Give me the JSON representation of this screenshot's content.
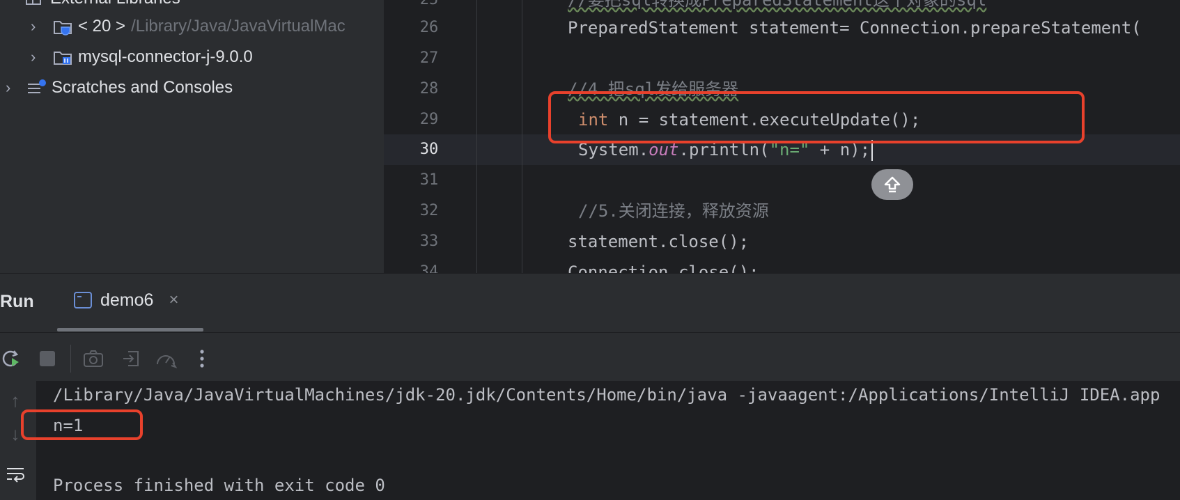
{
  "project_tree": {
    "items": [
      {
        "label": "External Libraries",
        "dim": ""
      },
      {
        "label": "< 20 >",
        "dim": "/Library/Java/JavaVirtualMac"
      },
      {
        "label": "mysql-connector-j-9.0.0",
        "dim": ""
      },
      {
        "label": "Scratches and Consoles",
        "dim": ""
      }
    ]
  },
  "editor": {
    "current_line": "30",
    "lines": [
      {
        "num": "25",
        "text": "//要把sql转换成PreparedStatement这个对象的sql"
      },
      {
        "num": "26",
        "text": "PreparedStatement statement= Connection.prepareStatement("
      },
      {
        "num": "27",
        "text": ""
      },
      {
        "num": "28",
        "text": "//4 把sql发给服务器"
      },
      {
        "num": "29",
        "kw": "int",
        "rest": " n = statement.executeUpdate();"
      },
      {
        "num": "30",
        "pre": "System.",
        "field": "out",
        "mid": ".println(",
        "str": "\"n=\"",
        "post": " + n);"
      },
      {
        "num": "31",
        "text": ""
      },
      {
        "num": "32",
        "text": "//5.关闭连接，释放资源"
      },
      {
        "num": "33",
        "text": "statement.close();"
      },
      {
        "num": "34",
        "text": "Connection.close();"
      }
    ]
  },
  "run_panel": {
    "title": "Run",
    "tab_label": "demo6",
    "close_glyph": "×",
    "console": [
      "/Library/Java/JavaVirtualMachines/jdk-20.jdk/Contents/Home/bin/java -javaagent:/Applications/IntelliJ IDEA.app",
      "n=1",
      "",
      "Process finished with exit code 0"
    ]
  },
  "colors": {
    "annotation": "#e8412c",
    "keyword": "#cf8e6d",
    "comment": "#7a7e85",
    "string": "#6aab73",
    "static_field": "#c77dbb"
  },
  "icons": {
    "tree": [
      "library-icon",
      "jdk-folder-icon",
      "library-folder-icon",
      "scratches-icon"
    ],
    "toolbar": [
      "rerun-icon",
      "stop-icon",
      "screenshot-icon",
      "restore-layout-icon",
      "profiler-icon",
      "more-icon"
    ],
    "console_gutter": [
      "scroll-up-icon",
      "scroll-down-icon",
      "soft-wrap-icon"
    ]
  }
}
